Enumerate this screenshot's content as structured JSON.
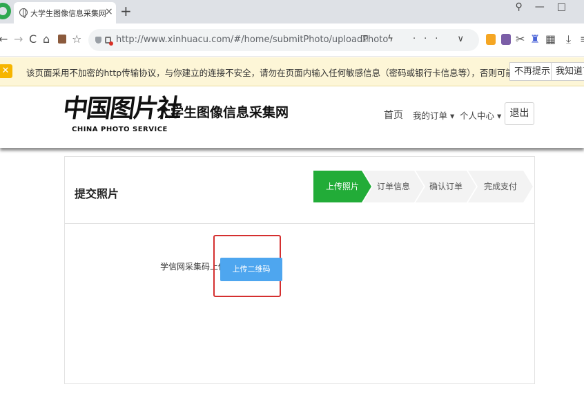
{
  "browser": {
    "tab_title": "大学生图像信息采集网",
    "tab_close": "×",
    "new_tab": "+",
    "url": "http://www.xinhuacu.com/#/home/submitPhoto/uploadPhoto",
    "url_tail": "⚿ ϟ ··· ∨"
  },
  "nav_icons": {
    "back": "←",
    "forward": "→",
    "reload": "C",
    "home": "⌂",
    "star": "☆"
  },
  "warning": {
    "text": "该页面采用不加密的http传输协议，与你建立的连接不安全，请勿在页面内输入任何敏感信息（密码或银行卡信息等），否则可能会被攻击者盗用",
    "dismiss_label": "不再提示",
    "ack_label": "我知道了"
  },
  "site": {
    "logo_cn": "中国图片社",
    "logo_en": "CHINA PHOTO SERVICE",
    "site_name": "大学生图像信息采集网",
    "nav": {
      "home": "首页",
      "orders": "我的订单 ▾",
      "profile": "个人中心 ▾",
      "logout": "退出"
    }
  },
  "page": {
    "title": "提交照片",
    "steps": [
      "上传照片",
      "订单信息",
      "确认订单",
      "完成支付"
    ],
    "active_step": 0,
    "upload_label": "学信网采集码上传：",
    "upload_button": "上传二维码"
  },
  "colors": {
    "accent_green": "#22ac38",
    "button_blue": "#4ea6ef",
    "highlight_red": "#d42f2f",
    "warning_bg": "#fdf6d7"
  }
}
